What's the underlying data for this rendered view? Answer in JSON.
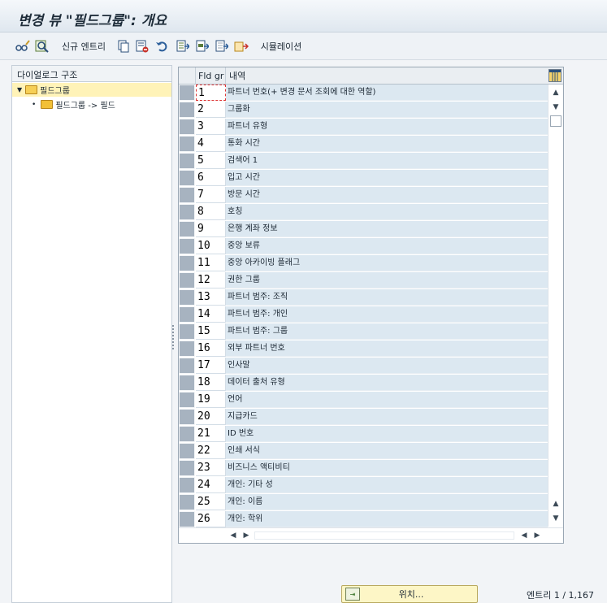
{
  "window": {
    "title": "변경 뷰 \"필드그룹\": 개요"
  },
  "toolbar": {
    "icons": [
      "glasses-pencil-icon",
      "find-icon",
      "copy-icon",
      "delete-icon",
      "undo-icon",
      "select-all-icon",
      "select-block-icon",
      "deselect-all-icon",
      "configure-icon"
    ],
    "new_entries_label": "신규 엔트리",
    "simulation_label": "시뮬레이션"
  },
  "left_pane": {
    "header": "다이얼로그 구조",
    "tree": [
      {
        "label": "필드그룹",
        "selected": true,
        "level": 0
      },
      {
        "label": "필드그룹 -> 필드",
        "selected": false,
        "level": 1
      }
    ]
  },
  "grid": {
    "columns": [
      "Fld gr",
      "내역"
    ],
    "rows": [
      {
        "fld": "1",
        "desc": "파트너 번호(+ 변경 문서 조회에 대한 역할)"
      },
      {
        "fld": "2",
        "desc": "그룹화"
      },
      {
        "fld": "3",
        "desc": "파트너 유형"
      },
      {
        "fld": "4",
        "desc": "통화 시간"
      },
      {
        "fld": "5",
        "desc": "검색어 1"
      },
      {
        "fld": "6",
        "desc": "입고 시간"
      },
      {
        "fld": "7",
        "desc": "방문 시간"
      },
      {
        "fld": "8",
        "desc": "호칭"
      },
      {
        "fld": "9",
        "desc": "은행 계좌 정보"
      },
      {
        "fld": "10",
        "desc": "중앙 보류"
      },
      {
        "fld": "11",
        "desc": "중앙 아카이빙 플래그"
      },
      {
        "fld": "12",
        "desc": "권한 그룹"
      },
      {
        "fld": "13",
        "desc": "파트너 범주: 조직"
      },
      {
        "fld": "14",
        "desc": "파트너 범주: 개인"
      },
      {
        "fld": "15",
        "desc": "파트너 범주: 그룹"
      },
      {
        "fld": "16",
        "desc": "외부 파트너 번호"
      },
      {
        "fld": "17",
        "desc": "인사말"
      },
      {
        "fld": "18",
        "desc": "데이터 출처 유형"
      },
      {
        "fld": "19",
        "desc": "언어"
      },
      {
        "fld": "20",
        "desc": "지급카드"
      },
      {
        "fld": "21",
        "desc": "ID 번호"
      },
      {
        "fld": "22",
        "desc": "인쇄 서식"
      },
      {
        "fld": "23",
        "desc": "비즈니스 액티비티"
      },
      {
        "fld": "24",
        "desc": "개인: 기타 성"
      },
      {
        "fld": "25",
        "desc": "개인: 이름"
      },
      {
        "fld": "26",
        "desc": "개인: 학위"
      }
    ]
  },
  "footer": {
    "position_button": "위치...",
    "entries": "엔트리 1 / 1,167"
  }
}
